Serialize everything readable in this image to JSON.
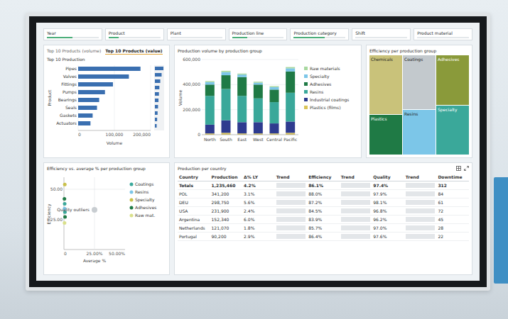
{
  "filters": [
    {
      "label": "Year",
      "level": 0.5
    },
    {
      "label": "Product",
      "level": 0.2
    },
    {
      "label": "Plant",
      "level": 0
    },
    {
      "label": "Production line",
      "level": 0.3
    },
    {
      "label": "Production category",
      "level": 0.6
    },
    {
      "label": "Shift",
      "level": 0
    },
    {
      "label": "Product material",
      "level": 0
    }
  ],
  "top_products": {
    "tabs": [
      {
        "label": "Top 10 Products (volume)",
        "selected": false
      },
      {
        "label": "Top 10 Products (value)",
        "selected": true
      }
    ],
    "subtitle": "Top 10 Production",
    "y_label": "Product",
    "x_label": "Volume",
    "ticks": [
      "0",
      "100,000",
      "200,000"
    ],
    "bars": [
      {
        "label": "Pipes",
        "value": 172000
      },
      {
        "label": "Valves",
        "value": 140000
      },
      {
        "label": "Fittings",
        "value": 96000
      },
      {
        "label": "Pumps",
        "value": 74000
      },
      {
        "label": "Bearings",
        "value": 58000
      },
      {
        "label": "Seals",
        "value": 52000
      },
      {
        "label": "Gaskets",
        "value": 40000
      },
      {
        "label": "Actuators",
        "value": 34000
      }
    ],
    "overview": [
      190000,
      150000,
      120000,
      100000,
      90000,
      80000,
      70000,
      60000,
      50000,
      40000
    ]
  },
  "production": {
    "title": "Production volume by production group",
    "y_label": "Volume",
    "ticks": [
      "0",
      "200,000",
      "400,000",
      "600,000"
    ],
    "categories": [
      "North",
      "South",
      "East",
      "West",
      "Central",
      "Pacific"
    ],
    "series": [
      {
        "name": "Plastics (films)",
        "color": "#d9c45a",
        "values": [
          10000,
          15000,
          10000,
          10000,
          10000,
          15000
        ]
      },
      {
        "name": "Industrial coatings",
        "color": "#2e3b8f",
        "values": [
          70000,
          100000,
          90000,
          90000,
          80000,
          90000
        ]
      },
      {
        "name": "Resins",
        "color": "#3aa89a",
        "values": [
          230000,
          250000,
          210000,
          190000,
          170000,
          230000
        ]
      },
      {
        "name": "Adhesives",
        "color": "#1f7a45",
        "values": [
          90000,
          110000,
          150000,
          110000,
          100000,
          170000
        ]
      },
      {
        "name": "Specialty",
        "color": "#7cc6e8",
        "values": [
          20000,
          25000,
          20000,
          15000,
          20000,
          25000
        ]
      },
      {
        "name": "Raw materials",
        "color": "#a8d8a0",
        "values": [
          8000,
          10000,
          8000,
          8000,
          8000,
          10000
        ]
      }
    ]
  },
  "efficiency": {
    "title": "Efficiency per production group",
    "columns": [
      [
        {
          "label": "Chemicals",
          "value": 60,
          "color": "#c9c27a"
        },
        {
          "label": "Plastics",
          "value": 40,
          "color": "#1f7a45"
        }
      ],
      [
        {
          "label": "Coatings",
          "value": 55,
          "color": "#c3c9cd"
        },
        {
          "label": "Resins",
          "value": 45,
          "color": "#7cc6e8"
        }
      ],
      [
        {
          "label": "Adhesives",
          "value": 50,
          "color": "#8a9a3a"
        },
        {
          "label": "Specialty",
          "value": 50,
          "color": "#3aa89a"
        }
      ]
    ]
  },
  "scatter": {
    "title": "Efficiency vs. average % per production group",
    "y_label": "Efficiency",
    "x_label": "Average %",
    "y_ticks": [
      "50.00",
      "25.00"
    ],
    "x_ticks": [
      "0",
      "25.00%",
      "50.00%"
    ],
    "series": [
      {
        "name": "Coatings",
        "color": "#3aa89a",
        "points": [
          [
            0.6,
            38
          ],
          [
            0.8,
            31
          ]
        ]
      },
      {
        "name": "Resins",
        "color": "#7cc6e8",
        "points": [
          [
            0.5,
            34
          ]
        ]
      },
      {
        "name": "Specialty",
        "color": "#c9c04a",
        "points": [
          [
            0.7,
            54
          ]
        ]
      },
      {
        "name": "Adhesives",
        "color": "#1f7a45",
        "points": [
          [
            0.4,
            42
          ],
          [
            0.9,
            27
          ]
        ]
      },
      {
        "name": "Raw mat.",
        "color": "#d9e08a",
        "points": [
          [
            0.5,
            22
          ]
        ]
      }
    ],
    "outlier": {
      "label": "Quality outliers",
      "x": 25,
      "y": 33
    }
  },
  "table": {
    "title": "Production per country",
    "columns": [
      {
        "label": "Country",
        "shaded": false
      },
      {
        "label": "Production",
        "shaded": false
      },
      {
        "label": "Δ% LY",
        "shaded": false
      },
      {
        "label": "Trend",
        "shaded": true
      },
      {
        "label": "Efficiency",
        "shaded": false
      },
      {
        "label": "Trend",
        "shaded": true
      },
      {
        "label": "Quality",
        "shaded": false
      },
      {
        "label": "Trend",
        "shaded": true
      },
      {
        "label": "Downtime",
        "shaded": false
      }
    ],
    "rows": [
      [
        "Totals",
        "1,235,460",
        "4.2%",
        "",
        "86.1%",
        "",
        "97.4%",
        "",
        "312"
      ],
      [
        "POL",
        "341,200",
        "3.1%",
        "",
        "88.0%",
        "",
        "97.9%",
        "",
        "84"
      ],
      [
        "DEU",
        "298,750",
        "5.6%",
        "",
        "87.2%",
        "",
        "98.1%",
        "",
        "61"
      ],
      [
        "USA",
        "231,900",
        "2.4%",
        "",
        "84.5%",
        "",
        "96.8%",
        "",
        "72"
      ],
      [
        "Argentina",
        "152,340",
        "6.0%",
        "",
        "83.9%",
        "",
        "96.2%",
        "",
        "45"
      ],
      [
        "Netherlands",
        "121,070",
        "1.8%",
        "",
        "85.7%",
        "",
        "97.0%",
        "",
        "28"
      ],
      [
        "Portugal",
        "90,200",
        "2.9%",
        "",
        "86.4%",
        "",
        "97.6%",
        "",
        "22"
      ]
    ]
  }
}
